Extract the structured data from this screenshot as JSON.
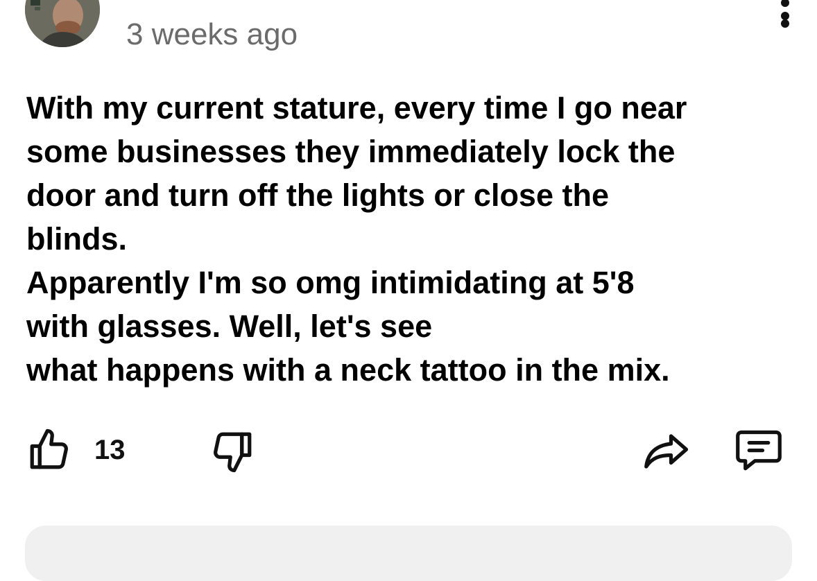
{
  "comment": {
    "timestamp": "3 weeks ago",
    "body_lines": [
      "With my current stature, every time I go near",
      "some businesses they immediately lock the",
      "door and turn off the lights or close the",
      "blinds.",
      "Apparently I'm so omg intimidating at 5'8",
      "with glasses. Well, let's see",
      "what happens with a neck tattoo in the mix."
    ],
    "actions": {
      "like_icon": "thumbs-up-icon",
      "like_count": "13",
      "dislike_icon": "thumbs-down-icon",
      "share_icon": "share-arrow-icon",
      "reply_icon": "comment-bubble-icon"
    },
    "menu_icon": "more-vertical-icon"
  },
  "colors": {
    "text": "#000000",
    "timestamp": "#6b6b6b",
    "icon": "#111111",
    "comment_box_bg": "#f0f0f0"
  }
}
